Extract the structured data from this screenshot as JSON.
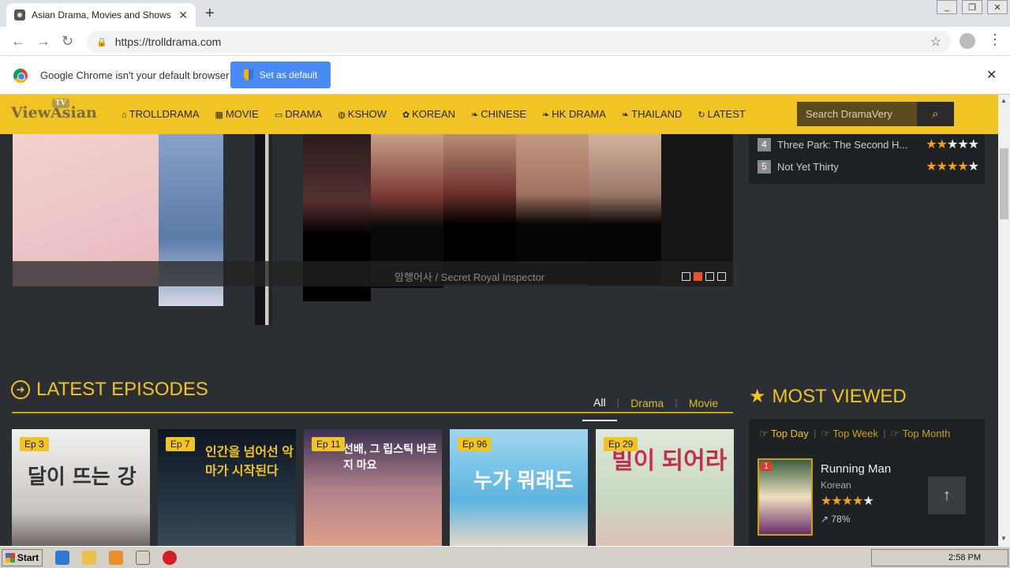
{
  "browser": {
    "tab_title": "Asian Drama, Movies and Shows Eng",
    "url": "https://trolldrama.com",
    "infobar_text": "Google Chrome isn't your default browser",
    "set_default_label": "Set as default"
  },
  "site": {
    "logo": "ViewAsian",
    "logo_badge": "TV",
    "nav": [
      {
        "icon": "home-icon",
        "glyph": "⌂",
        "label": "TROLLDRAMA"
      },
      {
        "icon": "film-icon",
        "glyph": "▦",
        "label": "MOVIE"
      },
      {
        "icon": "monitor-icon",
        "glyph": "▭",
        "label": "DRAMA"
      },
      {
        "icon": "dribbble-icon",
        "glyph": "◍",
        "label": "KSHOW"
      },
      {
        "icon": "flower-icon",
        "glyph": "✿",
        "label": "KOREAN"
      },
      {
        "icon": "leaf-icon",
        "glyph": "❧",
        "label": "CHINESE"
      },
      {
        "icon": "leaf-icon",
        "glyph": "❧",
        "label": "HK DRAMA"
      },
      {
        "icon": "leaf-icon",
        "glyph": "❧",
        "label": "THAILAND"
      },
      {
        "icon": "refresh-icon",
        "glyph": "↻",
        "label": "LATEST"
      }
    ],
    "search_placeholder": "Search DramaVery"
  },
  "slider": {
    "caption": "암행어사 / Secret Royal Inspector",
    "active_dot": 2,
    "dot_count": 4
  },
  "ranking": [
    {
      "num": "4",
      "name": "Three Park: The Second H...",
      "rating": 2
    },
    {
      "num": "5",
      "name": "Not Yet Thirty",
      "rating": 3.5
    }
  ],
  "latest": {
    "title": "LATEST EPISODES",
    "filters": [
      "All",
      "Drama",
      "Movie"
    ],
    "active_filter": "All",
    "episodes": [
      {
        "ep": "Ep 3",
        "poster_text": "달이 뜨는 강"
      },
      {
        "ep": "Ep 7",
        "poster_text": "인간을 넘어선 악마가 시작된다"
      },
      {
        "ep": "Ep 11",
        "poster_text": "선배, 그 립스틱 바르지 마요"
      },
      {
        "ep": "Ep 96",
        "poster_text": "누가 뭐래도"
      },
      {
        "ep": "Ep 29",
        "poster_text": "빌이 되어라"
      }
    ]
  },
  "most_viewed": {
    "title": "MOST VIEWED",
    "tabs": [
      "Top Day",
      "Top Week",
      "Top Month"
    ],
    "active_tab": "Top Day",
    "items": [
      {
        "rank": "1",
        "name": "Running Man",
        "category": "Korean",
        "rating": 4,
        "percent": "78%"
      }
    ]
  },
  "taskbar": {
    "start_label": "Start",
    "clock": "2:58 PM"
  }
}
